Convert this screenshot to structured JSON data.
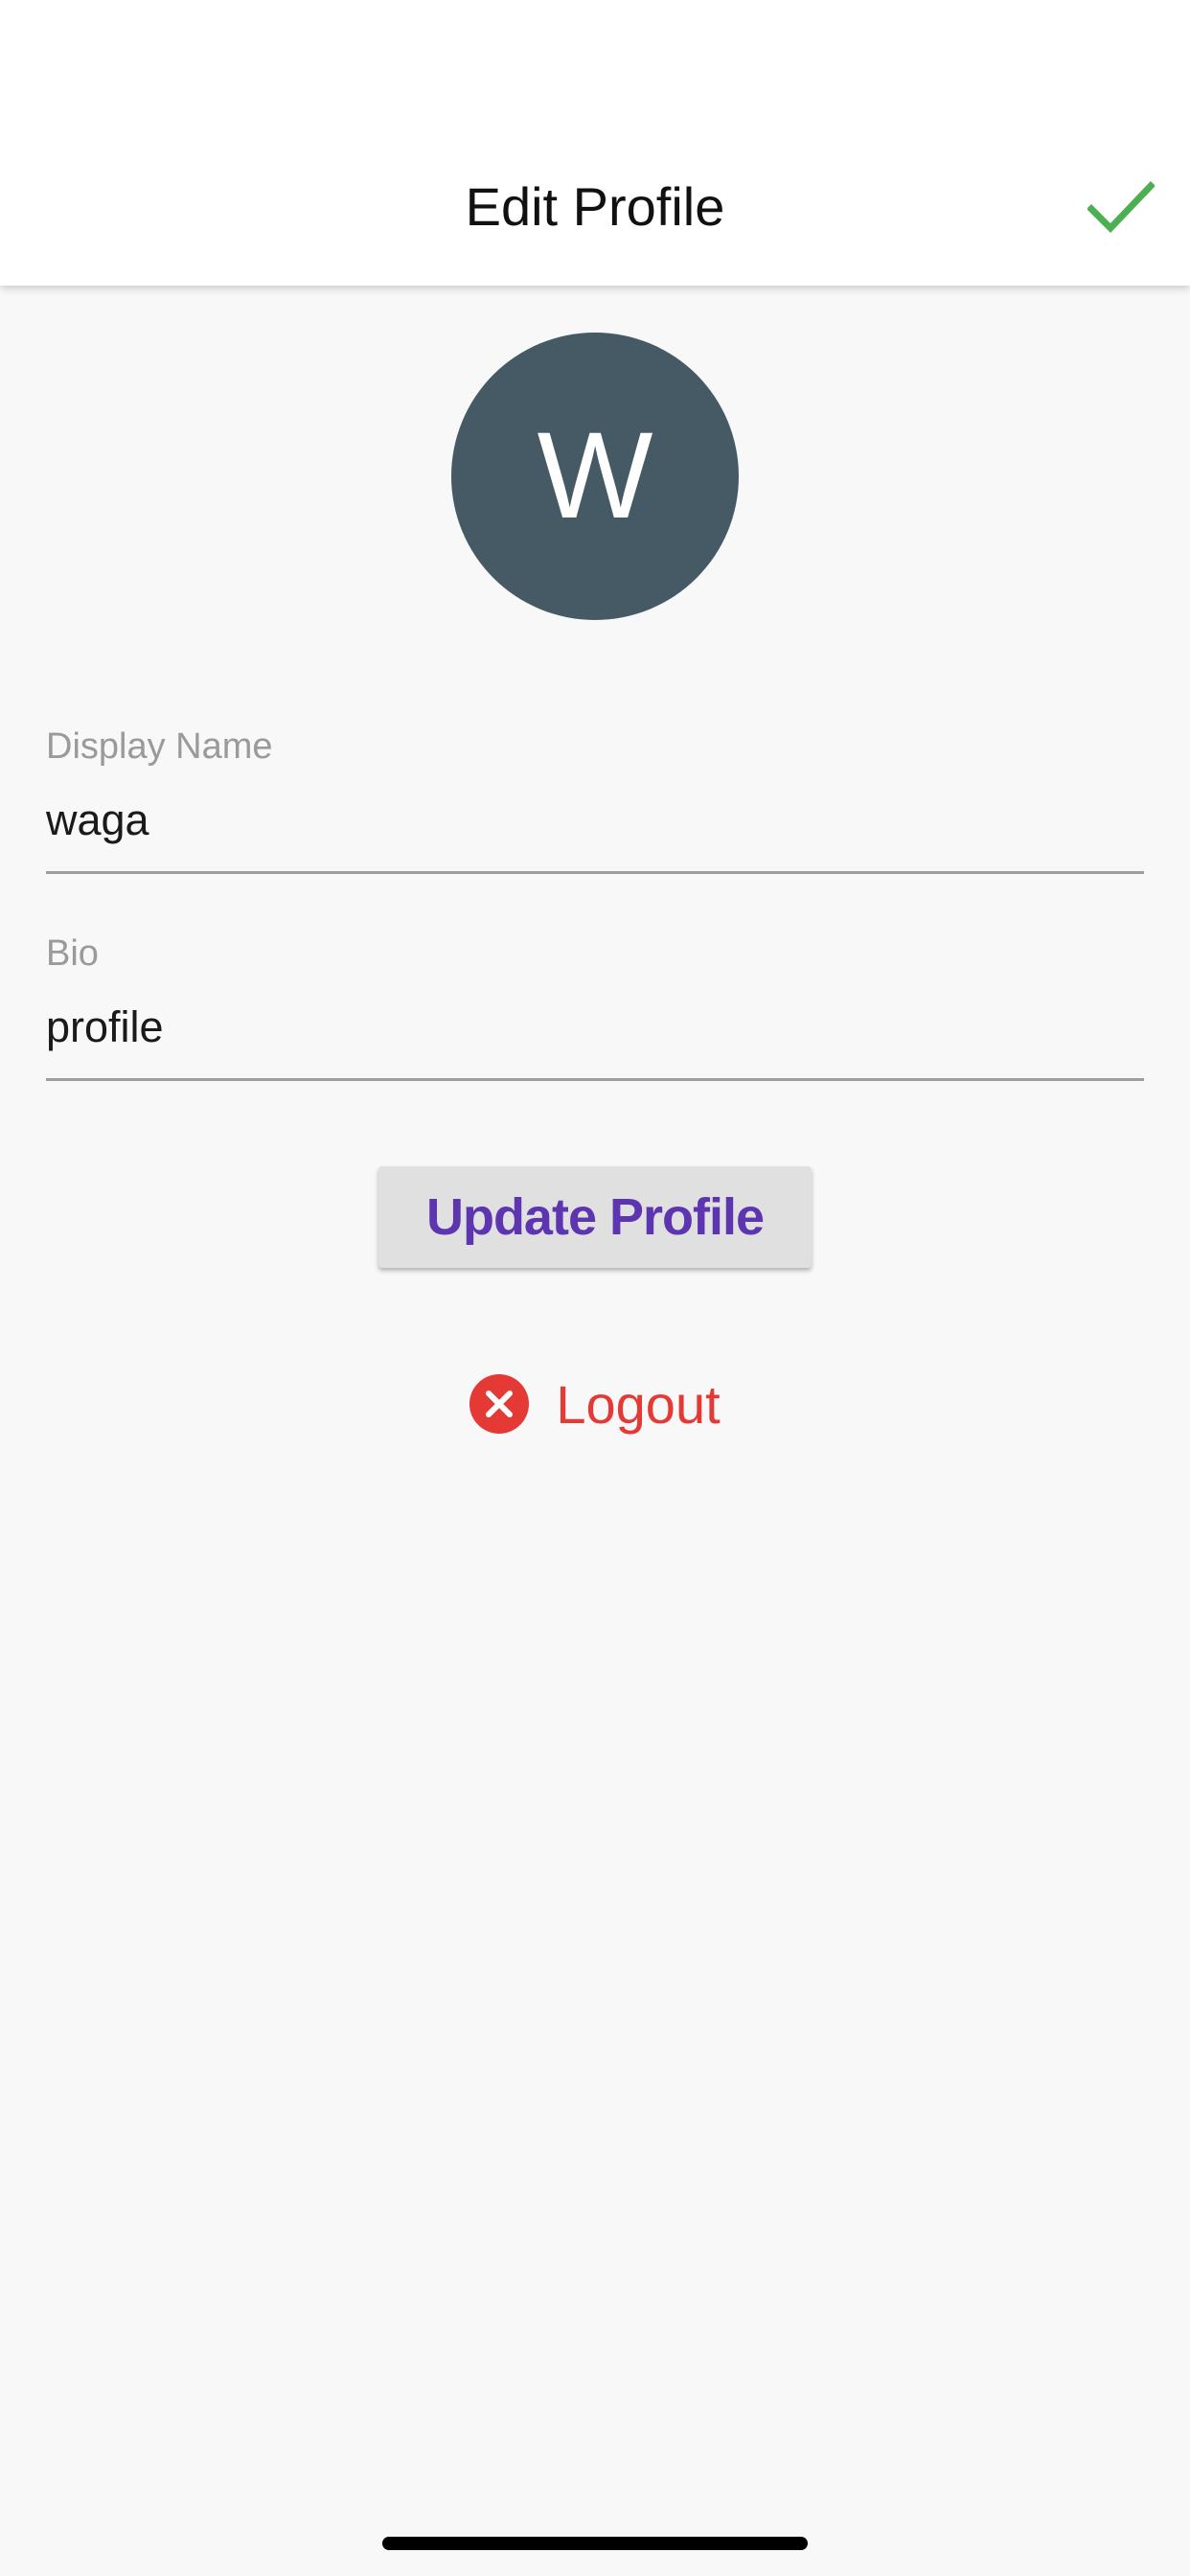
{
  "header": {
    "title": "Edit Profile",
    "confirm_icon": "check-icon",
    "confirm_color": "#4caf50"
  },
  "avatar": {
    "initial": "W",
    "background": "#455a64"
  },
  "form": {
    "display_name": {
      "label": "Display Name",
      "value": "waga"
    },
    "bio": {
      "label": "Bio",
      "value": "profile"
    }
  },
  "update_button": {
    "label": "Update Profile",
    "color": "#5e35b1"
  },
  "logout": {
    "label": "Logout",
    "icon": "close-circle-icon",
    "color": "#e53935"
  }
}
